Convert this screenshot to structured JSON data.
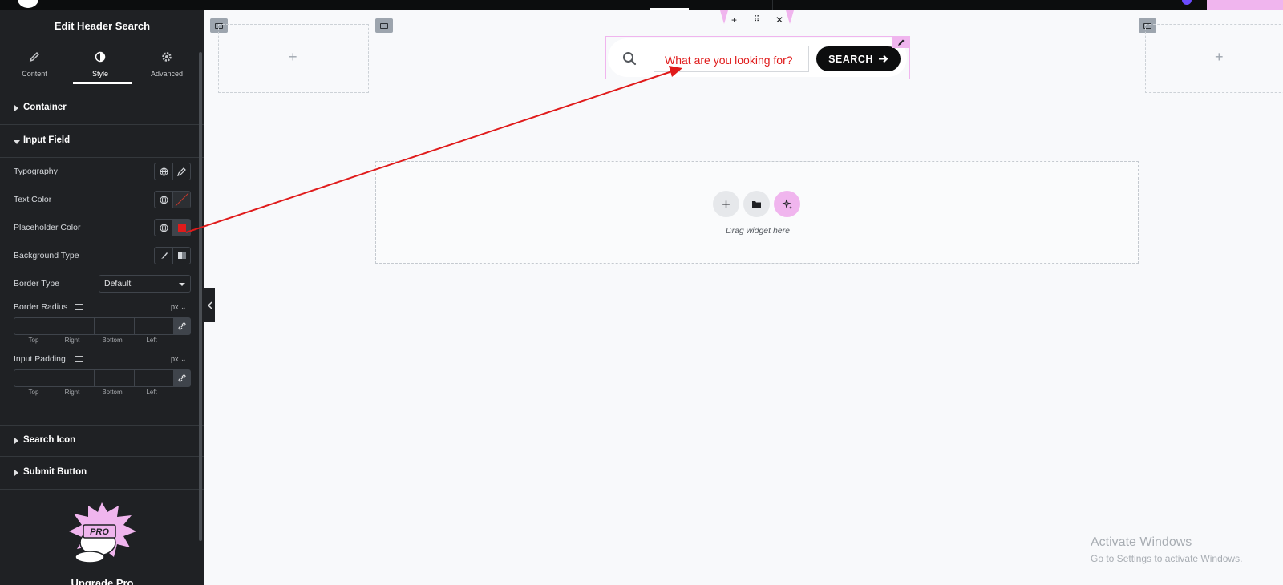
{
  "panel": {
    "title": "Edit Header Search",
    "tabs": [
      {
        "label": "Content",
        "icon": "pencil-icon"
      },
      {
        "label": "Style",
        "icon": "half-circle-icon"
      },
      {
        "label": "Advanced",
        "icon": "gear-icon"
      }
    ],
    "sections": {
      "container": "Container",
      "input_field": "Input Field",
      "search_icon": "Search Icon",
      "submit_button": "Submit Button"
    },
    "controls": {
      "typography": "Typography",
      "text_color": "Text Color",
      "placeholder_color": "Placeholder Color",
      "background_type": "Background Type",
      "border_type": "Border Type",
      "border_type_value": "Default",
      "border_radius": "Border Radius",
      "border_radius_unit": "px",
      "input_padding": "Input Padding",
      "input_padding_unit": "px",
      "dim_labels": [
        "Top",
        "Right",
        "Bottom",
        "Left"
      ]
    },
    "upgrade": {
      "badge": "PRO",
      "label": "Upgrade Pro"
    },
    "placeholder_color_value": "#e01b1b"
  },
  "canvas": {
    "search_placeholder": "What are you looking for?",
    "search_button": "SEARCH",
    "drop_text": "Drag widget here",
    "watermark_title": "Activate Windows",
    "watermark_sub": "Go to Settings to activate Windows."
  },
  "colors": {
    "accent_pink": "#f0b5ee",
    "panel_bg": "#1f2124",
    "annotation_red": "#e01b1b"
  }
}
